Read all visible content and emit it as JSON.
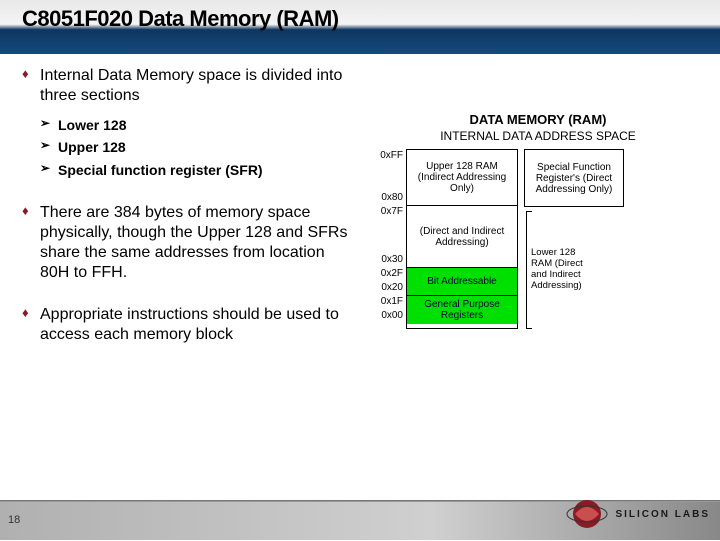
{
  "title": "C8051F020 Data Memory (RAM)",
  "bullets": {
    "b1": "Internal Data Memory space is divided into three sections",
    "b1_sub": [
      "Lower 128",
      "Upper 128",
      "Special function register (SFR)"
    ],
    "b2": "There are 384 bytes of memory space physically, though the Upper 128 and SFRs share the same addresses from location 80H to FFH.",
    "b3": "Appropriate instructions should be used to access each memory block"
  },
  "diagram": {
    "title": "DATA MEMORY (RAM)",
    "subtitle": "INTERNAL DATA  ADDRESS SPACE",
    "addresses": [
      "0xFF",
      "",
      "0x80",
      "0x7F",
      "",
      "",
      "0x30",
      "0x2F",
      "0x20",
      "0x1F",
      "0x00"
    ],
    "left_stack": {
      "upper128": "Upper 128 RAM (Indirect Addressing Only)",
      "direct_indirect": "(Direct and Indirect Addressing)",
      "bit_addressable": "Bit Addressable",
      "gpr": "General Purpose Registers"
    },
    "sfr": "Special Function Register's (Direct Addressing Only)",
    "lower_label": "Lower 128 RAM (Direct and Indirect Addressing)"
  },
  "page": "18",
  "brand": "SILICON LABS"
}
